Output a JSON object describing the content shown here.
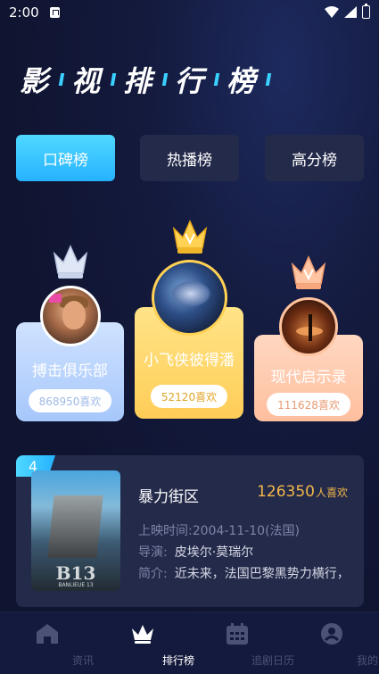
{
  "status_bar": {
    "time": "2:00"
  },
  "page": {
    "title_chars": [
      "影",
      "视",
      "排",
      "行",
      "榜"
    ]
  },
  "tabs": [
    {
      "label": "口碑榜",
      "active": true
    },
    {
      "label": "热播榜",
      "active": false
    },
    {
      "label": "高分榜",
      "active": false
    }
  ],
  "podium": [
    {
      "rank": 1,
      "name": "小飞侠彼得潘",
      "likes": "52120喜欢"
    },
    {
      "rank": 2,
      "name": "搏击俱乐部",
      "likes": "868950喜欢"
    },
    {
      "rank": 3,
      "name": "现代启示录",
      "likes": "111628喜欢"
    }
  ],
  "list": [
    {
      "rank": "4",
      "title": "暴力街区",
      "likes_num": "126350",
      "likes_unit": "人喜欢",
      "release_label": "上映时间:",
      "release_value": "2004-11-10(法国)",
      "director_label": "导演:",
      "director_value": "皮埃尔·莫瑞尔",
      "intro_label": "简介:",
      "intro_value": "近未来，法国巴黎黑势力横行，",
      "poster_logo": "B13",
      "poster_sub": "BANLIEUE 13"
    }
  ],
  "nav": [
    {
      "label": "资讯",
      "icon": "home-icon",
      "active": false
    },
    {
      "label": "排行榜",
      "icon": "crown-icon",
      "active": true
    },
    {
      "label": "追剧日历",
      "icon": "calendar-icon",
      "active": false
    },
    {
      "label": "我的",
      "icon": "profile-icon",
      "active": false
    }
  ],
  "colors": {
    "background": "#141a3d",
    "accent": "#26b2ff",
    "gold": "#ffd254",
    "likes": "#f3b84a"
  }
}
